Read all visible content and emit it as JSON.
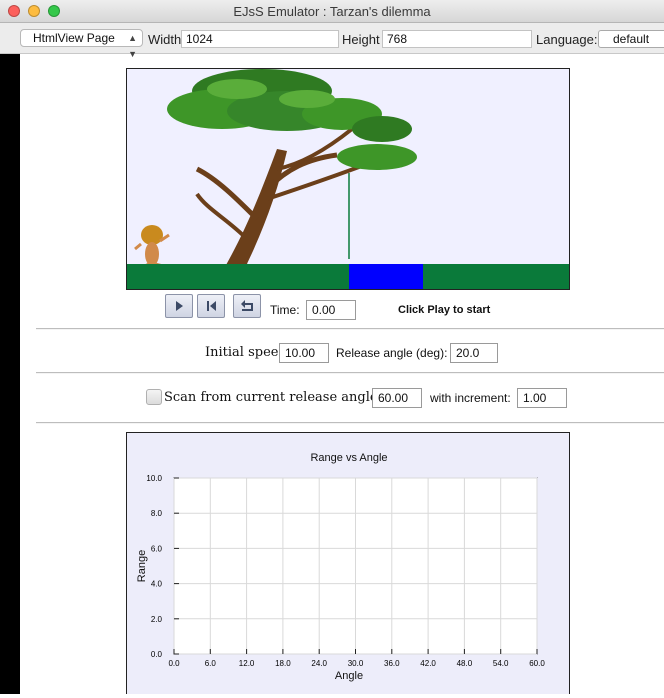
{
  "window": {
    "title": "EJsS Emulator : Tarzan's dilemma"
  },
  "toolbar": {
    "view_select": "HtmlView Page",
    "width_label": "Width",
    "width_value": "1024",
    "height_label": "Height",
    "height_value": "768",
    "language_label": "Language:",
    "language_value": "default"
  },
  "controls": {
    "time_label": "Time:",
    "time_value": "0.00",
    "status": "Click Play to start"
  },
  "params": {
    "speed_label": "Initial speed:",
    "speed_value": "10.00",
    "angle_label": "Release angle (deg):",
    "angle_value": "20.0"
  },
  "scan": {
    "label": "Scan from current release angle to:",
    "to_value": "60.00",
    "increment_label": "with increment:",
    "increment_value": "1.00"
  },
  "colors": {
    "ground": "#0a7a3a",
    "water": "#0000ff",
    "scene_bg": "#f0f0ff",
    "plot_bg": "#ededfa"
  },
  "chart_data": {
    "type": "scatter",
    "title": "Range vs Angle",
    "xlabel": "Angle",
    "ylabel": "Range",
    "xlim": [
      0,
      60
    ],
    "ylim": [
      0,
      10
    ],
    "x_ticks": [
      "0.0",
      "6.0",
      "12.0",
      "18.0",
      "24.0",
      "30.0",
      "36.0",
      "42.0",
      "48.0",
      "54.0",
      "60.0"
    ],
    "y_ticks": [
      "0.0",
      "2.0",
      "4.0",
      "6.0",
      "8.0",
      "10.0"
    ],
    "grid": true,
    "series": []
  }
}
